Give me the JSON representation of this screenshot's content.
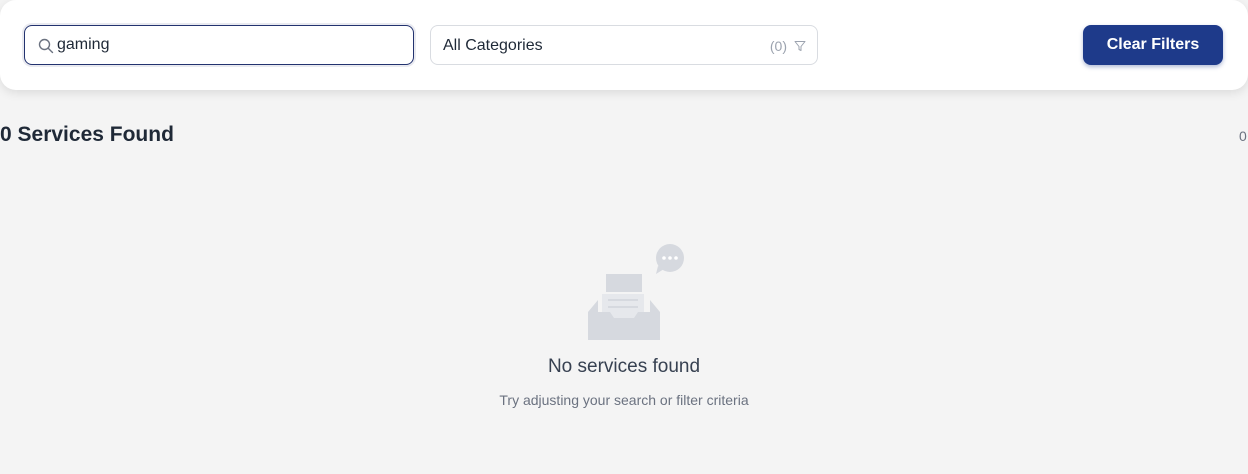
{
  "filters": {
    "search": {
      "value": "gaming",
      "placeholder": ""
    },
    "category": {
      "selected": "All Categories",
      "count": "(0)"
    },
    "clear_label": "Clear Filters"
  },
  "results": {
    "title": "0 Services Found",
    "count": "0"
  },
  "empty_state": {
    "title": "No services found",
    "subtitle": "Try adjusting your search or filter criteria"
  },
  "colors": {
    "accent": "#1e3a8a",
    "background": "#f4f4f4"
  },
  "icons": [
    "search-icon",
    "filter-icon",
    "empty-inbox-icon",
    "chat-bubble-icon"
  ]
}
